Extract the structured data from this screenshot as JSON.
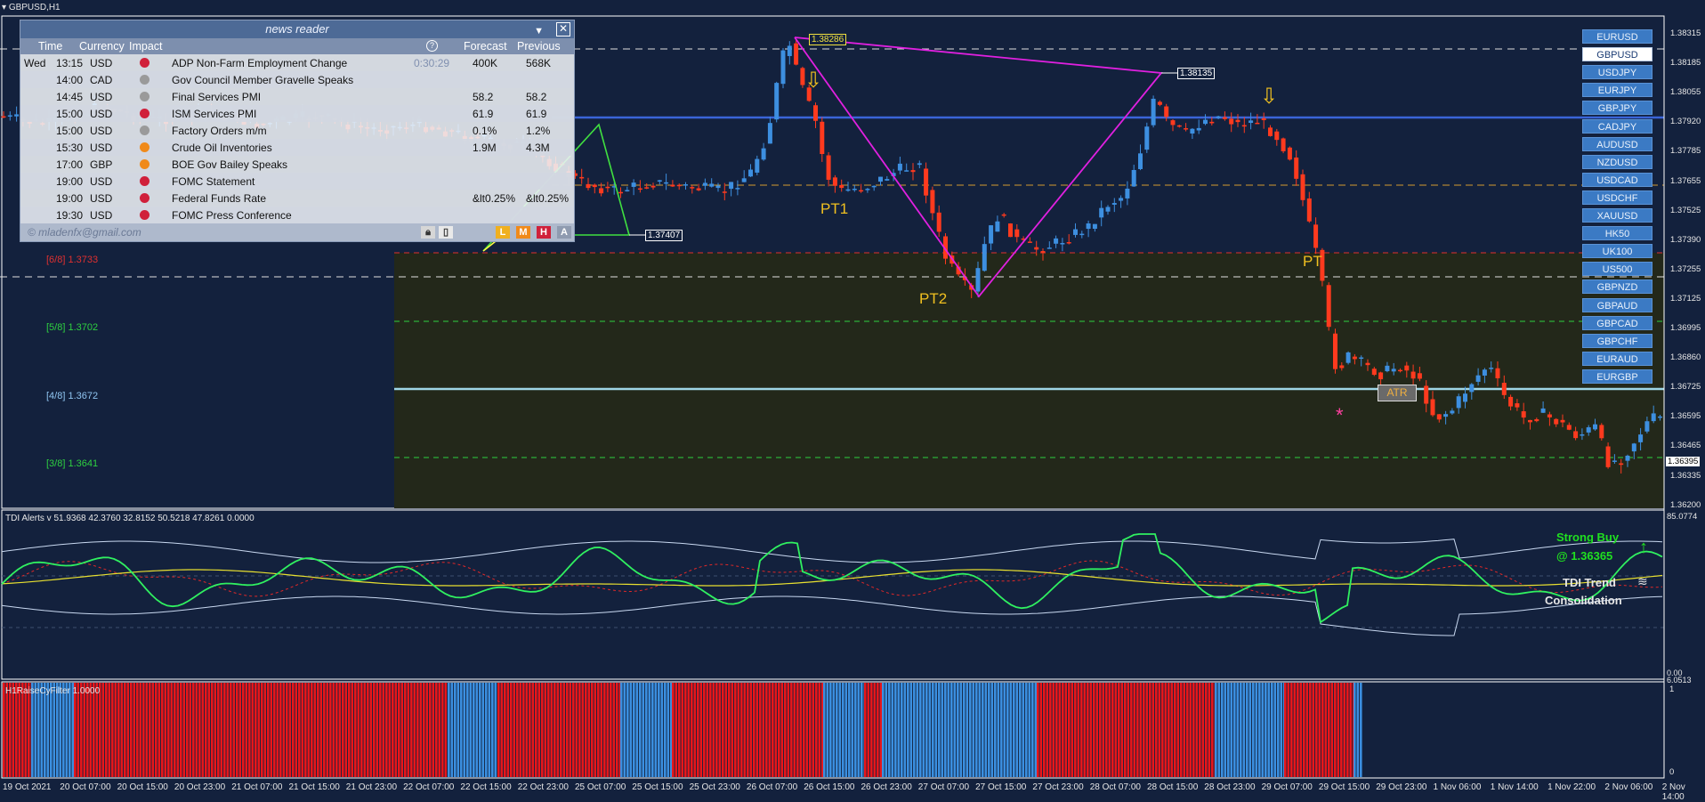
{
  "window": {
    "symbol": "GBPUSD,H1"
  },
  "news_reader": {
    "title": "news reader",
    "dropdown_icon": "chevron-down-icon",
    "close_icon": "close-icon",
    "columns": {
      "time": "Time",
      "currency": "Currency",
      "impact": "Impact",
      "clock": "?",
      "forecast": "Forecast",
      "previous": "Previous"
    },
    "rows": [
      {
        "day": "Wed",
        "time": "13:15",
        "currency": "USD",
        "impact_color": "#d0203a",
        "event": "ADP Non-Farm Employment Change",
        "countdown": "0:30:29",
        "forecast": "400K",
        "previous": "568K"
      },
      {
        "day": "",
        "time": "14:00",
        "currency": "CAD",
        "impact_color": "#9a9a9a",
        "event": "Gov Council Member Gravelle Speaks",
        "countdown": "",
        "forecast": "",
        "previous": ""
      },
      {
        "day": "",
        "time": "14:45",
        "currency": "USD",
        "impact_color": "#9a9a9a",
        "event": "Final Services PMI",
        "countdown": "",
        "forecast": "58.2",
        "previous": "58.2"
      },
      {
        "day": "",
        "time": "15:00",
        "currency": "USD",
        "impact_color": "#d0203a",
        "event": "ISM Services PMI",
        "countdown": "",
        "forecast": "61.9",
        "previous": "61.9"
      },
      {
        "day": "",
        "time": "15:00",
        "currency": "USD",
        "impact_color": "#9a9a9a",
        "event": "Factory Orders m/m",
        "countdown": "",
        "forecast": "0.1%",
        "previous": "1.2%"
      },
      {
        "day": "",
        "time": "15:30",
        "currency": "USD",
        "impact_color": "#f08a1a",
        "event": "Crude Oil Inventories",
        "countdown": "",
        "forecast": "1.9M",
        "previous": "4.3M"
      },
      {
        "day": "",
        "time": "17:00",
        "currency": "GBP",
        "impact_color": "#f08a1a",
        "event": "BOE Gov Bailey Speaks",
        "countdown": "",
        "forecast": "",
        "previous": ""
      },
      {
        "day": "",
        "time": "19:00",
        "currency": "USD",
        "impact_color": "#d0203a",
        "event": "FOMC Statement",
        "countdown": "",
        "forecast": "",
        "previous": ""
      },
      {
        "day": "",
        "time": "19:00",
        "currency": "USD",
        "impact_color": "#d0203a",
        "event": "Federal Funds Rate",
        "countdown": "",
        "forecast": "&lt0.25%",
        "previous": "&lt0.25%"
      },
      {
        "day": "",
        "time": "19:30",
        "currency": "USD",
        "impact_color": "#d0203a",
        "event": "FOMC Press Conference",
        "countdown": "",
        "forecast": "",
        "previous": ""
      }
    ],
    "footer_email": "© mladenfx@gmail.com",
    "footer_buttons": [
      {
        "label": "L",
        "color": "#f0b020"
      },
      {
        "label": "M",
        "color": "#f08a1a"
      },
      {
        "label": "H",
        "color": "#d0203a"
      },
      {
        "label": "A",
        "color": "#8f9bb0"
      }
    ],
    "footer_icons": [
      "lock-icon",
      "window-icon"
    ]
  },
  "symbols": [
    "EURUSD",
    "GBPUSD",
    "USDJPY",
    "EURJPY",
    "GBPJPY",
    "CADJPY",
    "AUDUSD",
    "NZDUSD",
    "USDCAD",
    "USDCHF",
    "XAUUSD",
    "HK50",
    "UK100",
    "US500",
    "GBPNZD",
    "GBPAUD",
    "GBPCAD",
    "GBPCHF",
    "EURAUD",
    "EURGBP"
  ],
  "active_symbol": "GBPUSD",
  "price_axis": [
    "1.38315",
    "1.38185",
    "1.38055",
    "1.37920",
    "1.37785",
    "1.37655",
    "1.37525",
    "1.37390",
    "1.37255",
    "1.37125",
    "1.36995",
    "1.36860",
    "1.36725",
    "1.36595",
    "1.36465",
    "1.36335",
    "1.36200"
  ],
  "current_price": "1.36395",
  "murrey_levels": [
    {
      "label": "[6/8]",
      "value": "1.3733",
      "color": "#e03030"
    },
    {
      "label": "[5/8]",
      "value": "1.3702",
      "color": "#2ed040"
    },
    {
      "label": "[4/8]",
      "value": "1.3672",
      "color": "#8fc4f0"
    },
    {
      "label": "[3/8]",
      "value": "1.3641",
      "color": "#2ed040"
    }
  ],
  "pattern_labels": {
    "pt1": "PT1",
    "pt2": "PT2",
    "pt": "PT",
    "price_top": "1.38286",
    "price_right": "1.38135",
    "price_left": "1.37407",
    "atr": "ATR",
    "star": "*"
  },
  "arrow_icons": [
    "down-arrow-icon",
    "down-arrow-icon"
  ],
  "tdi": {
    "header": "TDI Alerts v 51.9368 42.3760 32.8152 50.5218 47.8261 0.0000",
    "signal": "Strong Buy",
    "signal_price": "@ 1.36365",
    "trend_label": "TDI Trend",
    "trend_state": "Consolidation",
    "axis_top": "85.0774",
    "axis_bottom": "6.0513",
    "axis_bottom_prefix": "0.00"
  },
  "filter": {
    "header": "H1RaiseCyFilter 1.0000",
    "axis_top": "1",
    "axis_bottom": "0",
    "segments": [
      [
        "R",
        0,
        32
      ],
      [
        "B",
        32,
        80
      ],
      [
        "R",
        80,
        500
      ],
      [
        "B",
        500,
        556
      ],
      [
        "R",
        556,
        694
      ],
      [
        "B",
        694,
        752
      ],
      [
        "R",
        752,
        922
      ],
      [
        "B",
        922,
        968
      ],
      [
        "R",
        968,
        988
      ],
      [
        "B",
        988,
        1162
      ],
      [
        "R",
        1162,
        1362
      ],
      [
        "B",
        1362,
        1440
      ],
      [
        "R",
        1440,
        1518
      ],
      [
        "B",
        1518,
        1528
      ]
    ]
  },
  "time_axis": [
    "19 Oct 2021",
    "20 Oct 07:00",
    "20 Oct 15:00",
    "20 Oct 23:00",
    "21 Oct 07:00",
    "21 Oct 15:00",
    "21 Oct 23:00",
    "22 Oct 07:00",
    "22 Oct 15:00",
    "22 Oct 23:00",
    "25 Oct 07:00",
    "25 Oct 15:00",
    "25 Oct 23:00",
    "26 Oct 07:00",
    "26 Oct 15:00",
    "26 Oct 23:00",
    "27 Oct 07:00",
    "27 Oct 15:00",
    "27 Oct 23:00",
    "28 Oct 07:00",
    "28 Oct 15:00",
    "28 Oct 23:00",
    "29 Oct 07:00",
    "29 Oct 15:00",
    "29 Oct 23:00",
    "1 Nov 06:00",
    "1 Nov 14:00",
    "1 Nov 22:00",
    "2 Nov 06:00",
    "2 Nov 14:00"
  ],
  "colors": {
    "background": "#13213d",
    "bull": "#3d8fe0",
    "bear": "#ff3a1e",
    "zone": "#23281a",
    "filter_red": "#e8161a",
    "filter_blue": "#3b8fe0"
  }
}
